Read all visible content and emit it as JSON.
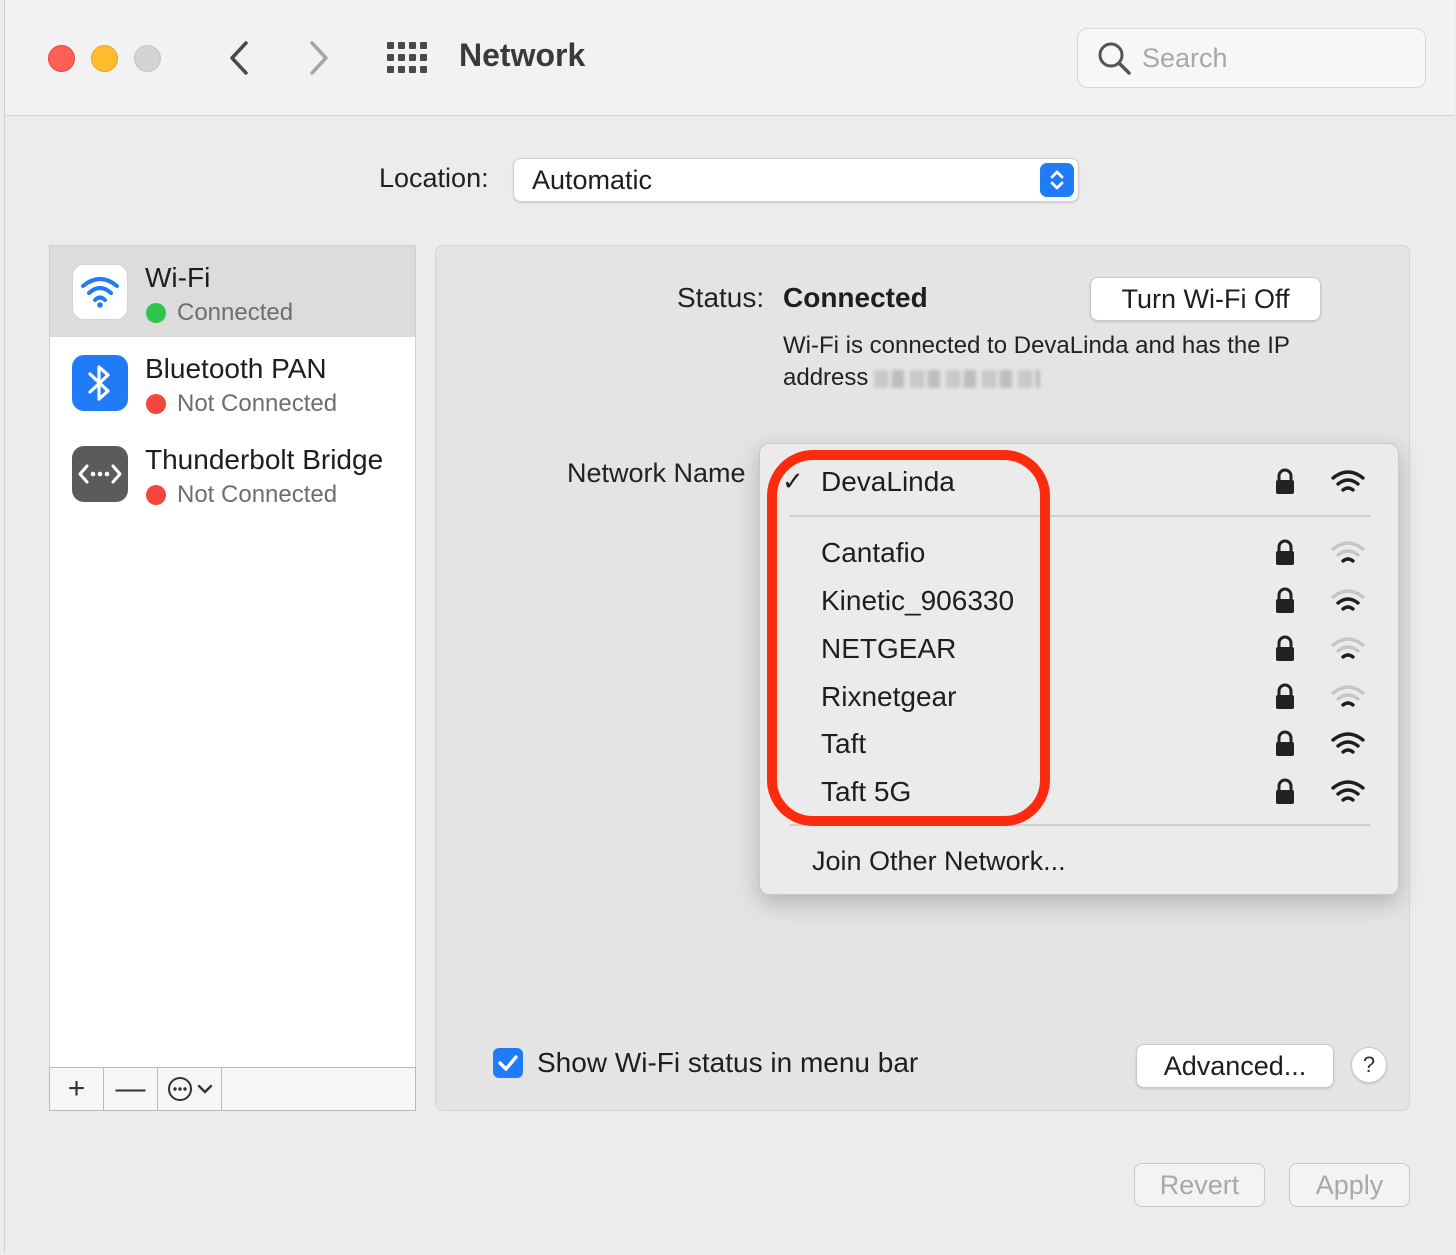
{
  "window": {
    "title": "Network",
    "search_placeholder": "Search"
  },
  "location": {
    "label": "Location:",
    "value": "Automatic"
  },
  "sidebar": {
    "services": [
      {
        "name": "Wi-Fi",
        "status": "Connected",
        "status_color": "#2ec54a",
        "icon": "wifi-icon",
        "selected": true
      },
      {
        "name": "Bluetooth PAN",
        "status": "Not Connected",
        "status_color": "#f2473c",
        "icon": "bluetooth-icon",
        "selected": false
      },
      {
        "name": "Thunderbolt Bridge",
        "status": "Not Connected",
        "status_color": "#f2473c",
        "icon": "thunderbolt-bridge-icon",
        "selected": false
      }
    ],
    "toolbar": {
      "add": "+",
      "remove": "—"
    }
  },
  "detail": {
    "status_label": "Status:",
    "status_value": "Connected",
    "turn_off_label": "Turn Wi-Fi Off",
    "description_line1": "Wi-Fi is connected to DevaLinda and has the IP",
    "description_line2": "address",
    "network_name_label": "Network Name",
    "show_status_label": "Show Wi-Fi status in menu bar",
    "show_status_checked": true,
    "advanced_label": "Advanced...",
    "help_label": "?",
    "revert_label": "Revert",
    "apply_label": "Apply"
  },
  "network_menu": {
    "current": {
      "name": "DevaLinda",
      "checked": true,
      "locked": true,
      "signal": 3
    },
    "networks": [
      {
        "name": "Cantafio",
        "locked": true,
        "signal": 1
      },
      {
        "name": "Kinetic_906330",
        "locked": true,
        "signal": 2
      },
      {
        "name": "NETGEAR",
        "locked": true,
        "signal": 1
      },
      {
        "name": "Rixnetgear",
        "locked": true,
        "signal": 1
      },
      {
        "name": "Taft",
        "locked": true,
        "signal": 3
      },
      {
        "name": "Taft 5G",
        "locked": true,
        "signal": 3
      }
    ],
    "join_other": "Join Other Network..."
  },
  "colors": {
    "accent": "#1f7cf6",
    "highlight": "#fe2a0e"
  }
}
